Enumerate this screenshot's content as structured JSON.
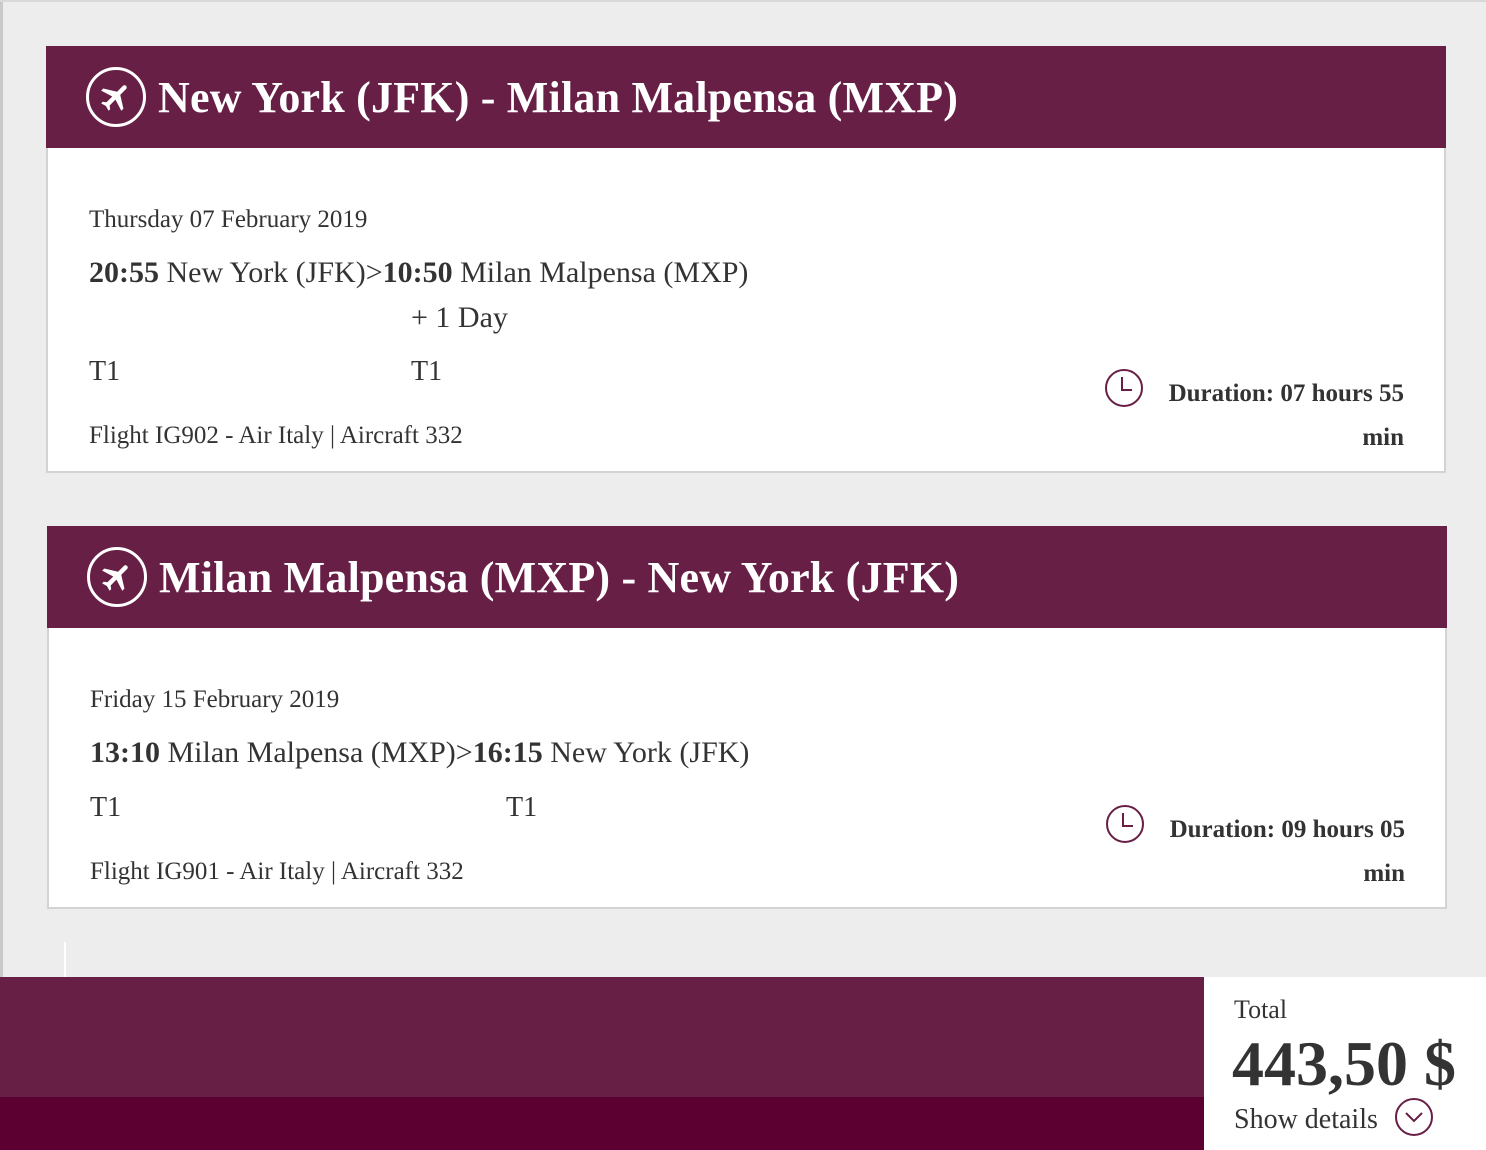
{
  "colors": {
    "brand": "#681f46",
    "brand_dark": "#5b0030",
    "text": "#333333"
  },
  "flights": [
    {
      "title": "New York (JFK) - Milan Malpensa (MXP)",
      "icon": "airplane-icon",
      "date": "Thursday 07 February 2019",
      "depart_time": "20:55",
      "depart_place": "New York (JFK)",
      "separator": ">",
      "arrive_time": "10:50",
      "arrive_place": "Milan Malpensa (MXP)",
      "day_offset": "+ 1 Day",
      "depart_terminal": "T1",
      "arrive_terminal": "T1",
      "flight_info": "Flight IG902 - Air Italy | Aircraft 332",
      "duration_line1": "Duration: 07 hours 55",
      "duration_line2": "min"
    },
    {
      "title": "Milan Malpensa (MXP) - New York (JFK)",
      "icon": "airplane-icon",
      "date": "Friday 15 February 2019",
      "depart_time": "13:10",
      "depart_place": "Milan Malpensa (MXP)",
      "separator": ">",
      "arrive_time": "16:15",
      "arrive_place": "New York (JFK)",
      "depart_terminal": "T1",
      "arrive_terminal": "T1",
      "flight_info": "Flight IG901 - Air Italy | Aircraft 332",
      "duration_line1": "Duration: 09 hours 05",
      "duration_line2": "min"
    }
  ],
  "summary": {
    "total_label": "Total",
    "total_amount": "443,50 $",
    "show_details": "Show details",
    "details_icon": "chevron-down-icon"
  }
}
